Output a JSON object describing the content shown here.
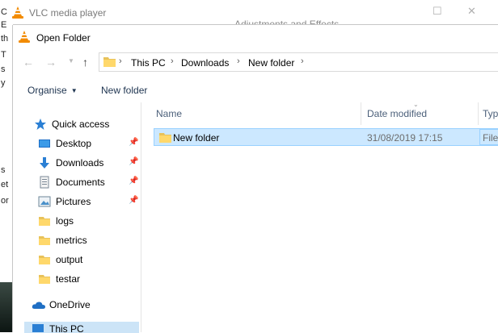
{
  "vlc": {
    "title": "VLC media player",
    "adjustments_title": "Adjustments and Effects",
    "left_fragments": [
      "C",
      "E",
      "th",
      "T",
      "s",
      "y",
      "s",
      "et",
      "or"
    ]
  },
  "dialog": {
    "title": "Open Folder",
    "breadcrumb": [
      "This PC",
      "Downloads",
      "New folder"
    ],
    "toolbar": {
      "organise": "Organise",
      "new_folder": "New folder"
    },
    "nav_items": [
      {
        "label": "Quick access",
        "icon": "star-icon",
        "pinned": false
      },
      {
        "label": "Desktop",
        "icon": "desktop-icon",
        "pinned": true
      },
      {
        "label": "Downloads",
        "icon": "download-icon",
        "pinned": true
      },
      {
        "label": "Documents",
        "icon": "documents-icon",
        "pinned": true
      },
      {
        "label": "Pictures",
        "icon": "pictures-icon",
        "pinned": true
      },
      {
        "label": "logs",
        "icon": "folder-icon",
        "pinned": false
      },
      {
        "label": "metrics",
        "icon": "folder-icon",
        "pinned": false
      },
      {
        "label": "output",
        "icon": "folder-icon",
        "pinned": false
      },
      {
        "label": "testar",
        "icon": "folder-icon",
        "pinned": false
      },
      {
        "label": "OneDrive",
        "icon": "onedrive-icon",
        "pinned": false
      },
      {
        "label": "This PC",
        "icon": "this-pc-icon",
        "pinned": false
      }
    ],
    "columns": {
      "name": "Name",
      "date_modified": "Date modified",
      "type": "Typ"
    },
    "files": [
      {
        "name": "New folder",
        "date_modified": "31/08/2019 17:15",
        "type": "File"
      }
    ]
  }
}
